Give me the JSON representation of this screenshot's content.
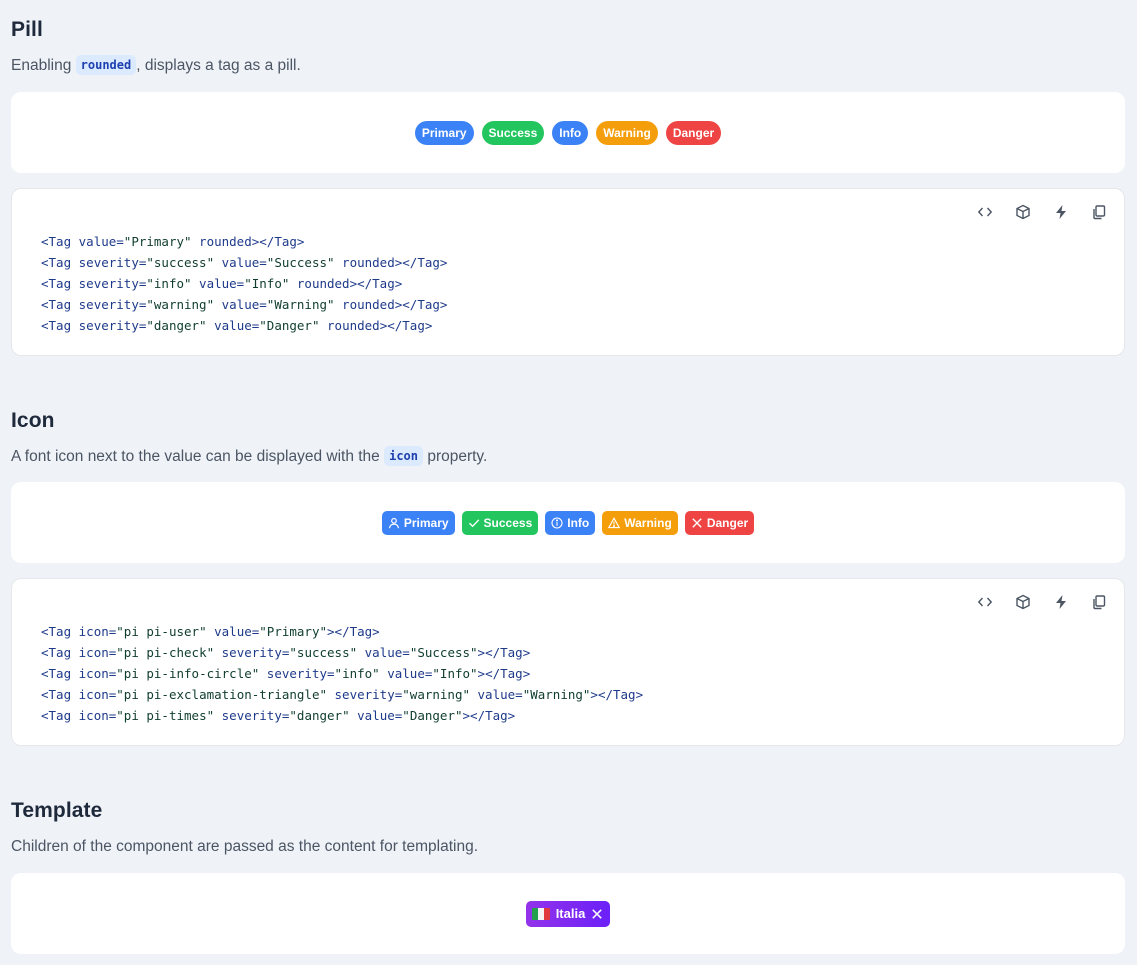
{
  "pill": {
    "title": "Pill",
    "desc_before": "Enabling ",
    "desc_code": "rounded",
    "desc_after": ", displays a tag as a pill.",
    "tags": [
      "Primary",
      "Success",
      "Info",
      "Warning",
      "Danger"
    ],
    "code_lines": [
      [
        "<Tag ",
        "value=",
        "\"Primary\"",
        " rounded></Tag>"
      ],
      [
        "<Tag ",
        "severity=",
        "\"success\"",
        " value=",
        "\"Success\"",
        " rounded></Tag>"
      ],
      [
        "<Tag ",
        "severity=",
        "\"info\"",
        " value=",
        "\"Info\"",
        " rounded></Tag>"
      ],
      [
        "<Tag ",
        "severity=",
        "\"warning\"",
        " value=",
        "\"Warning\"",
        " rounded></Tag>"
      ],
      [
        "<Tag ",
        "severity=",
        "\"danger\"",
        " value=",
        "\"Danger\"",
        " rounded></Tag>"
      ]
    ]
  },
  "icon": {
    "title": "Icon",
    "desc_before": "A font icon next to the value can be displayed with the ",
    "desc_code": "icon",
    "desc_after": " property.",
    "tags": [
      {
        "label": "Primary",
        "icon": "user-icon"
      },
      {
        "label": "Success",
        "icon": "check-icon"
      },
      {
        "label": "Info",
        "icon": "info-circle-icon"
      },
      {
        "label": "Warning",
        "icon": "exclamation-triangle-icon"
      },
      {
        "label": "Danger",
        "icon": "times-icon"
      }
    ],
    "code_lines": [
      [
        "<Tag ",
        "icon=",
        "\"pi pi-user\"",
        " value=",
        "\"Primary\"",
        "></Tag>"
      ],
      [
        "<Tag ",
        "icon=",
        "\"pi pi-check\"",
        " severity=",
        "\"success\"",
        " value=",
        "\"Success\"",
        "></Tag>"
      ],
      [
        "<Tag ",
        "icon=",
        "\"pi pi-info-circle\"",
        " severity=",
        "\"info\"",
        " value=",
        "\"Info\"",
        "></Tag>"
      ],
      [
        "<Tag ",
        "icon=",
        "\"pi pi-exclamation-triangle\"",
        " severity=",
        "\"warning\"",
        " value=",
        "\"Warning\"",
        "></Tag>"
      ],
      [
        "<Tag ",
        "icon=",
        "\"pi pi-times\"",
        " severity=",
        "\"danger\"",
        " value=",
        "\"Danger\"",
        "></Tag>"
      ]
    ]
  },
  "template": {
    "title": "Template",
    "desc": "Children of the component are passed as the content for templating.",
    "tag_label": "Italia"
  },
  "toolbar_icons": [
    "code-icon",
    "box-icon",
    "bolt-icon",
    "copy-icon"
  ],
  "colors": {
    "primary": "#3b82f6",
    "success": "#22c55e",
    "info": "#3b82f6",
    "warning": "#f59e0b",
    "danger": "#ef4444",
    "template_gradient_start": "#9333ea",
    "template_gradient_end": "#6b21f8"
  }
}
